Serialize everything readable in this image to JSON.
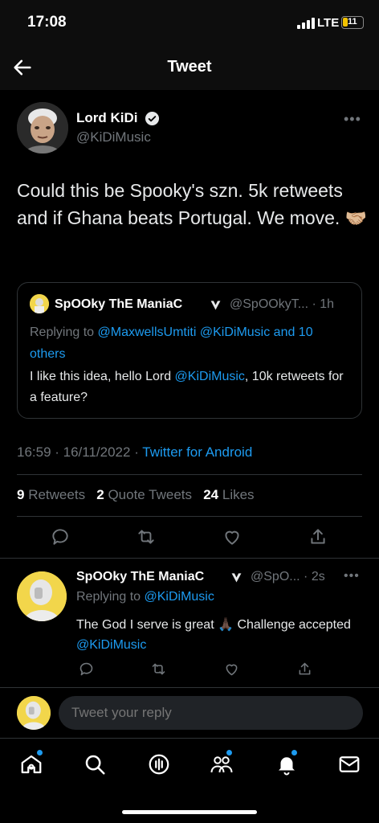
{
  "status_bar": {
    "time": "17:08",
    "network": "LTE",
    "battery": "11"
  },
  "header": {
    "title": "Tweet"
  },
  "tweet": {
    "author_name": "Lord KiDi",
    "author_handle": "@KiDiMusic",
    "text": "Could this be Spooky's szn. 5k retweets and if Ghana beats Portugal. We move.",
    "emoji": "🤝🏼",
    "timestamp": "16:59 · 16/11/2022 · ",
    "source": "Twitter for Android",
    "stats": {
      "retweets_count": "9",
      "retweets_label": "Retweets",
      "quotes_count": "2",
      "quotes_label": "Quote Tweets",
      "likes_count": "24",
      "likes_label": "Likes"
    }
  },
  "quoted_tweet": {
    "author_name": "SpOOky ThE ManiaC",
    "author_handle": "@SpOOkyT... · 1h",
    "replying_prefix": "Replying to ",
    "replying_to": "@MaxwellsUmtiti @KiDiMusic and 10 others",
    "text_before": "I like this idea, hello Lord ",
    "mention": "@KiDiMusic",
    "text_after": ", 10k retweets for a feature?"
  },
  "reply": {
    "author_name": "SpOOky ThE ManiaC",
    "author_handle": "@SpO... · 2s",
    "replying_prefix": "Replying to ",
    "replying_to": "@KiDiMusic",
    "text_before": "The God I serve is great ",
    "emoji": "🙏🏿",
    "text_middle": " Challenge accepted ",
    "mention": "@KiDiMusic"
  },
  "composer": {
    "placeholder": "Tweet your reply"
  },
  "colors": {
    "accent": "#1d9bf0",
    "background": "#000000",
    "secondary_text": "#71767b"
  },
  "icons": {
    "actions": [
      "reply-icon",
      "retweet-icon",
      "like-icon",
      "share-icon"
    ],
    "nav": [
      "home-icon",
      "search-icon",
      "spaces-icon",
      "communities-icon",
      "notifications-icon",
      "messages-icon"
    ]
  }
}
